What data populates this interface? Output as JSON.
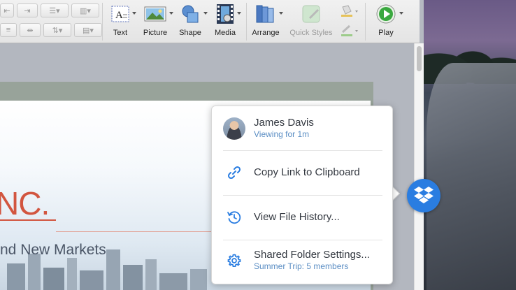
{
  "toolbar": {
    "tools": [
      {
        "id": "text",
        "label": "Text",
        "icon": "text-box-icon"
      },
      {
        "id": "picture",
        "label": "Picture",
        "icon": "picture-icon"
      },
      {
        "id": "shape",
        "label": "Shape",
        "icon": "shape-icon"
      },
      {
        "id": "media",
        "label": "Media",
        "icon": "media-film-icon"
      },
      {
        "id": "arrange",
        "label": "Arrange",
        "icon": "arrange-icon"
      },
      {
        "id": "quick_styles",
        "label": "Quick Styles",
        "icon": "quick-styles-icon",
        "disabled": true
      },
      {
        "id": "play",
        "label": "Play",
        "icon": "play-icon"
      }
    ]
  },
  "slide": {
    "title": "NC.",
    "subtitle": "nd New Markets"
  },
  "popover": {
    "user": {
      "name": "James Davis",
      "status": "Viewing for 1m"
    },
    "items": [
      {
        "label": "Copy Link to Clipboard",
        "icon": "link-icon"
      },
      {
        "label": "View File History...",
        "icon": "history-icon"
      },
      {
        "label": "Shared Folder Settings...",
        "sublabel": "Summer Trip: 5 members",
        "icon": "gear-icon"
      }
    ]
  },
  "colors": {
    "dropbox_blue": "#2a7de1",
    "link_blue": "#5b8ec4",
    "slide_title": "#d2553f",
    "play_green": "#3aa83f"
  }
}
